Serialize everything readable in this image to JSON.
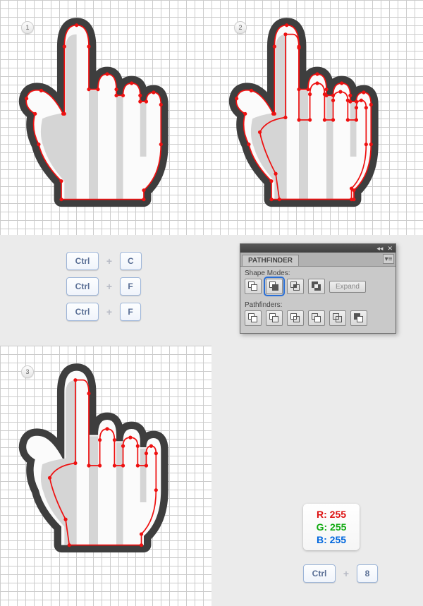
{
  "steps": {
    "s1": "1",
    "s2": "2",
    "s3": "3"
  },
  "shortcuts": {
    "row1": {
      "k1": "Ctrl",
      "k2": "C"
    },
    "row2": {
      "k1": "Ctrl",
      "k2": "F"
    },
    "row3": {
      "k1": "Ctrl",
      "k2": "F"
    }
  },
  "pathfinder": {
    "title": "PATHFINDER",
    "section_modes": "Shape Modes:",
    "section_pf": "Pathfinders:",
    "expand": "Expand",
    "titlebar_chevrons": "◂◂",
    "titlebar_close": "✕",
    "menu_glyph": "▾≡",
    "modes": [
      {
        "name": "unite"
      },
      {
        "name": "minus-front"
      },
      {
        "name": "intersect"
      },
      {
        "name": "exclude"
      }
    ],
    "paths": [
      {
        "name": "divide"
      },
      {
        "name": "trim"
      },
      {
        "name": "merge"
      },
      {
        "name": "crop"
      },
      {
        "name": "outline"
      },
      {
        "name": "minus-back"
      }
    ]
  },
  "rgb": {
    "r_label": "R:",
    "r_val": "255",
    "g_label": "G:",
    "g_val": "255",
    "b_label": "B:",
    "b_val": "255"
  },
  "bottom_shortcut": {
    "k1": "Ctrl",
    "k2": "8"
  },
  "plus": "+"
}
